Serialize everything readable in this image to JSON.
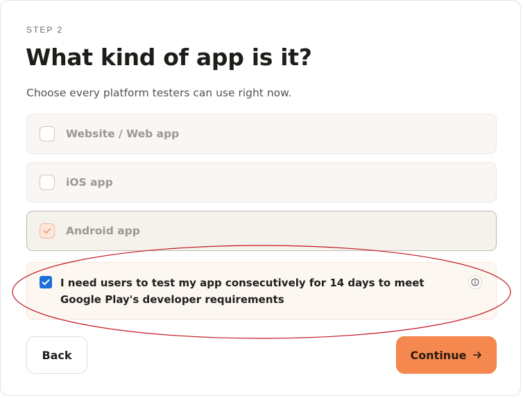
{
  "step_label": "STEP 2",
  "title": "What kind of app is it?",
  "subtitle": "Choose every platform testers can use right now.",
  "options": [
    {
      "label": "Website / Web app",
      "checked": false
    },
    {
      "label": "iOS app",
      "checked": false
    },
    {
      "label": "Android app",
      "checked": true
    }
  ],
  "requirement": {
    "text": "I need users to test my app consecutively for 14 days to meet Google Play's developer requirements",
    "checked": true
  },
  "buttons": {
    "back_label": "Back",
    "continue_label": "Continue"
  },
  "colors": {
    "accent": "#f4884e",
    "checkbox_blue": "#1a6fd9",
    "annotation_red": "#c0141c"
  },
  "icons": [
    "check-icon",
    "info-icon",
    "arrow-right-icon"
  ]
}
